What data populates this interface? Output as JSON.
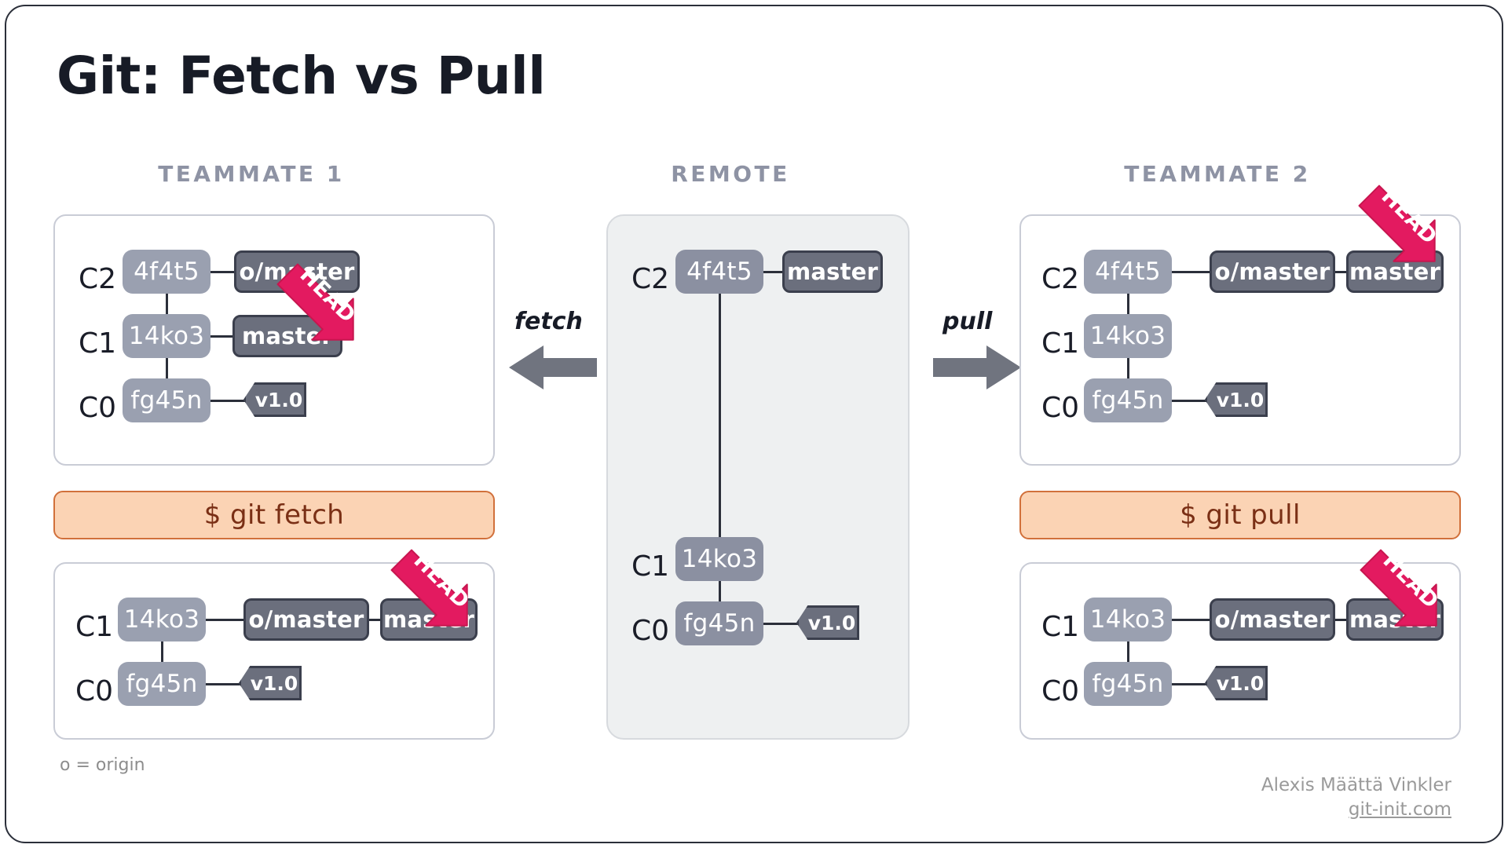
{
  "page": {
    "title": "Git: Fetch vs Pull",
    "legend": "o = origin",
    "credit_name": "Alexis Määttä Vinkler",
    "credit_link": "git-init.com"
  },
  "colors": {
    "frame_border": "#2b2f3a",
    "title_text": "#171b26",
    "column_header": "#8e93a4",
    "commit_fill": "#9aa0b0",
    "branch_fill": "#6b6f7d",
    "branch_border": "#3b3f4d",
    "head_arrow": "#e31a60",
    "head_arrow_dark": "#b81450",
    "command_bar_fill": "#fbd3b4",
    "command_bar_border": "#d1703b",
    "command_bar_text": "#7a2f15",
    "remote_panel_fill": "#eef0f1",
    "transfer_arrow": "#70747f",
    "footer_text": "#9a9a9a"
  },
  "columns": [
    {
      "id": "teammate1",
      "header": "TEAMMATE 1"
    },
    {
      "id": "remote",
      "header": "REMOTE"
    },
    {
      "id": "teammate2",
      "header": "TEAMMATE 2"
    }
  ],
  "transfers": [
    {
      "id": "fetch",
      "label": "fetch",
      "direction": "left"
    },
    {
      "id": "pull",
      "label": "pull",
      "direction": "right"
    }
  ],
  "commands": [
    {
      "id": "git-fetch",
      "label": "$ git fetch"
    },
    {
      "id": "git-pull",
      "label": "$ git pull"
    }
  ],
  "head_label": "HEAD",
  "panels": {
    "teammate1_before": {
      "rows": [
        {
          "commit_label": "C2",
          "hash": "4f4t5",
          "refs": [
            {
              "type": "branch",
              "name": "o/master"
            }
          ]
        },
        {
          "commit_label": "C1",
          "hash": "14ko3",
          "refs": [
            {
              "type": "branch",
              "name": "master",
              "head": true
            }
          ]
        },
        {
          "commit_label": "C0",
          "hash": "fg45n",
          "refs": [
            {
              "type": "tag",
              "name": "v1.0"
            }
          ]
        }
      ]
    },
    "teammate1_after": {
      "rows": [
        {
          "commit_label": "C1",
          "hash": "14ko3",
          "refs": [
            {
              "type": "branch",
              "name": "o/master"
            },
            {
              "type": "branch",
              "name": "master",
              "head": true
            }
          ]
        },
        {
          "commit_label": "C0",
          "hash": "fg45n",
          "refs": [
            {
              "type": "tag",
              "name": "v1.0"
            }
          ]
        }
      ]
    },
    "remote": {
      "rows": [
        {
          "commit_label": "C2",
          "hash": "4f4t5",
          "refs": [
            {
              "type": "branch",
              "name": "master"
            }
          ]
        },
        {
          "commit_label": "C1",
          "hash": "14ko3",
          "refs": []
        },
        {
          "commit_label": "C0",
          "hash": "fg45n",
          "refs": [
            {
              "type": "tag",
              "name": "v1.0"
            }
          ]
        }
      ]
    },
    "teammate2_before": {
      "rows": [
        {
          "commit_label": "C2",
          "hash": "4f4t5",
          "refs": [
            {
              "type": "branch",
              "name": "o/master"
            },
            {
              "type": "branch",
              "name": "master",
              "head": true
            }
          ]
        },
        {
          "commit_label": "C1",
          "hash": "14ko3",
          "refs": []
        },
        {
          "commit_label": "C0",
          "hash": "fg45n",
          "refs": [
            {
              "type": "tag",
              "name": "v1.0"
            }
          ]
        }
      ]
    },
    "teammate2_after": {
      "rows": [
        {
          "commit_label": "C1",
          "hash": "14ko3",
          "refs": [
            {
              "type": "branch",
              "name": "o/master"
            },
            {
              "type": "branch",
              "name": "master",
              "head": true
            }
          ]
        },
        {
          "commit_label": "C0",
          "hash": "fg45n",
          "refs": [
            {
              "type": "tag",
              "name": "v1.0"
            }
          ]
        }
      ]
    }
  }
}
